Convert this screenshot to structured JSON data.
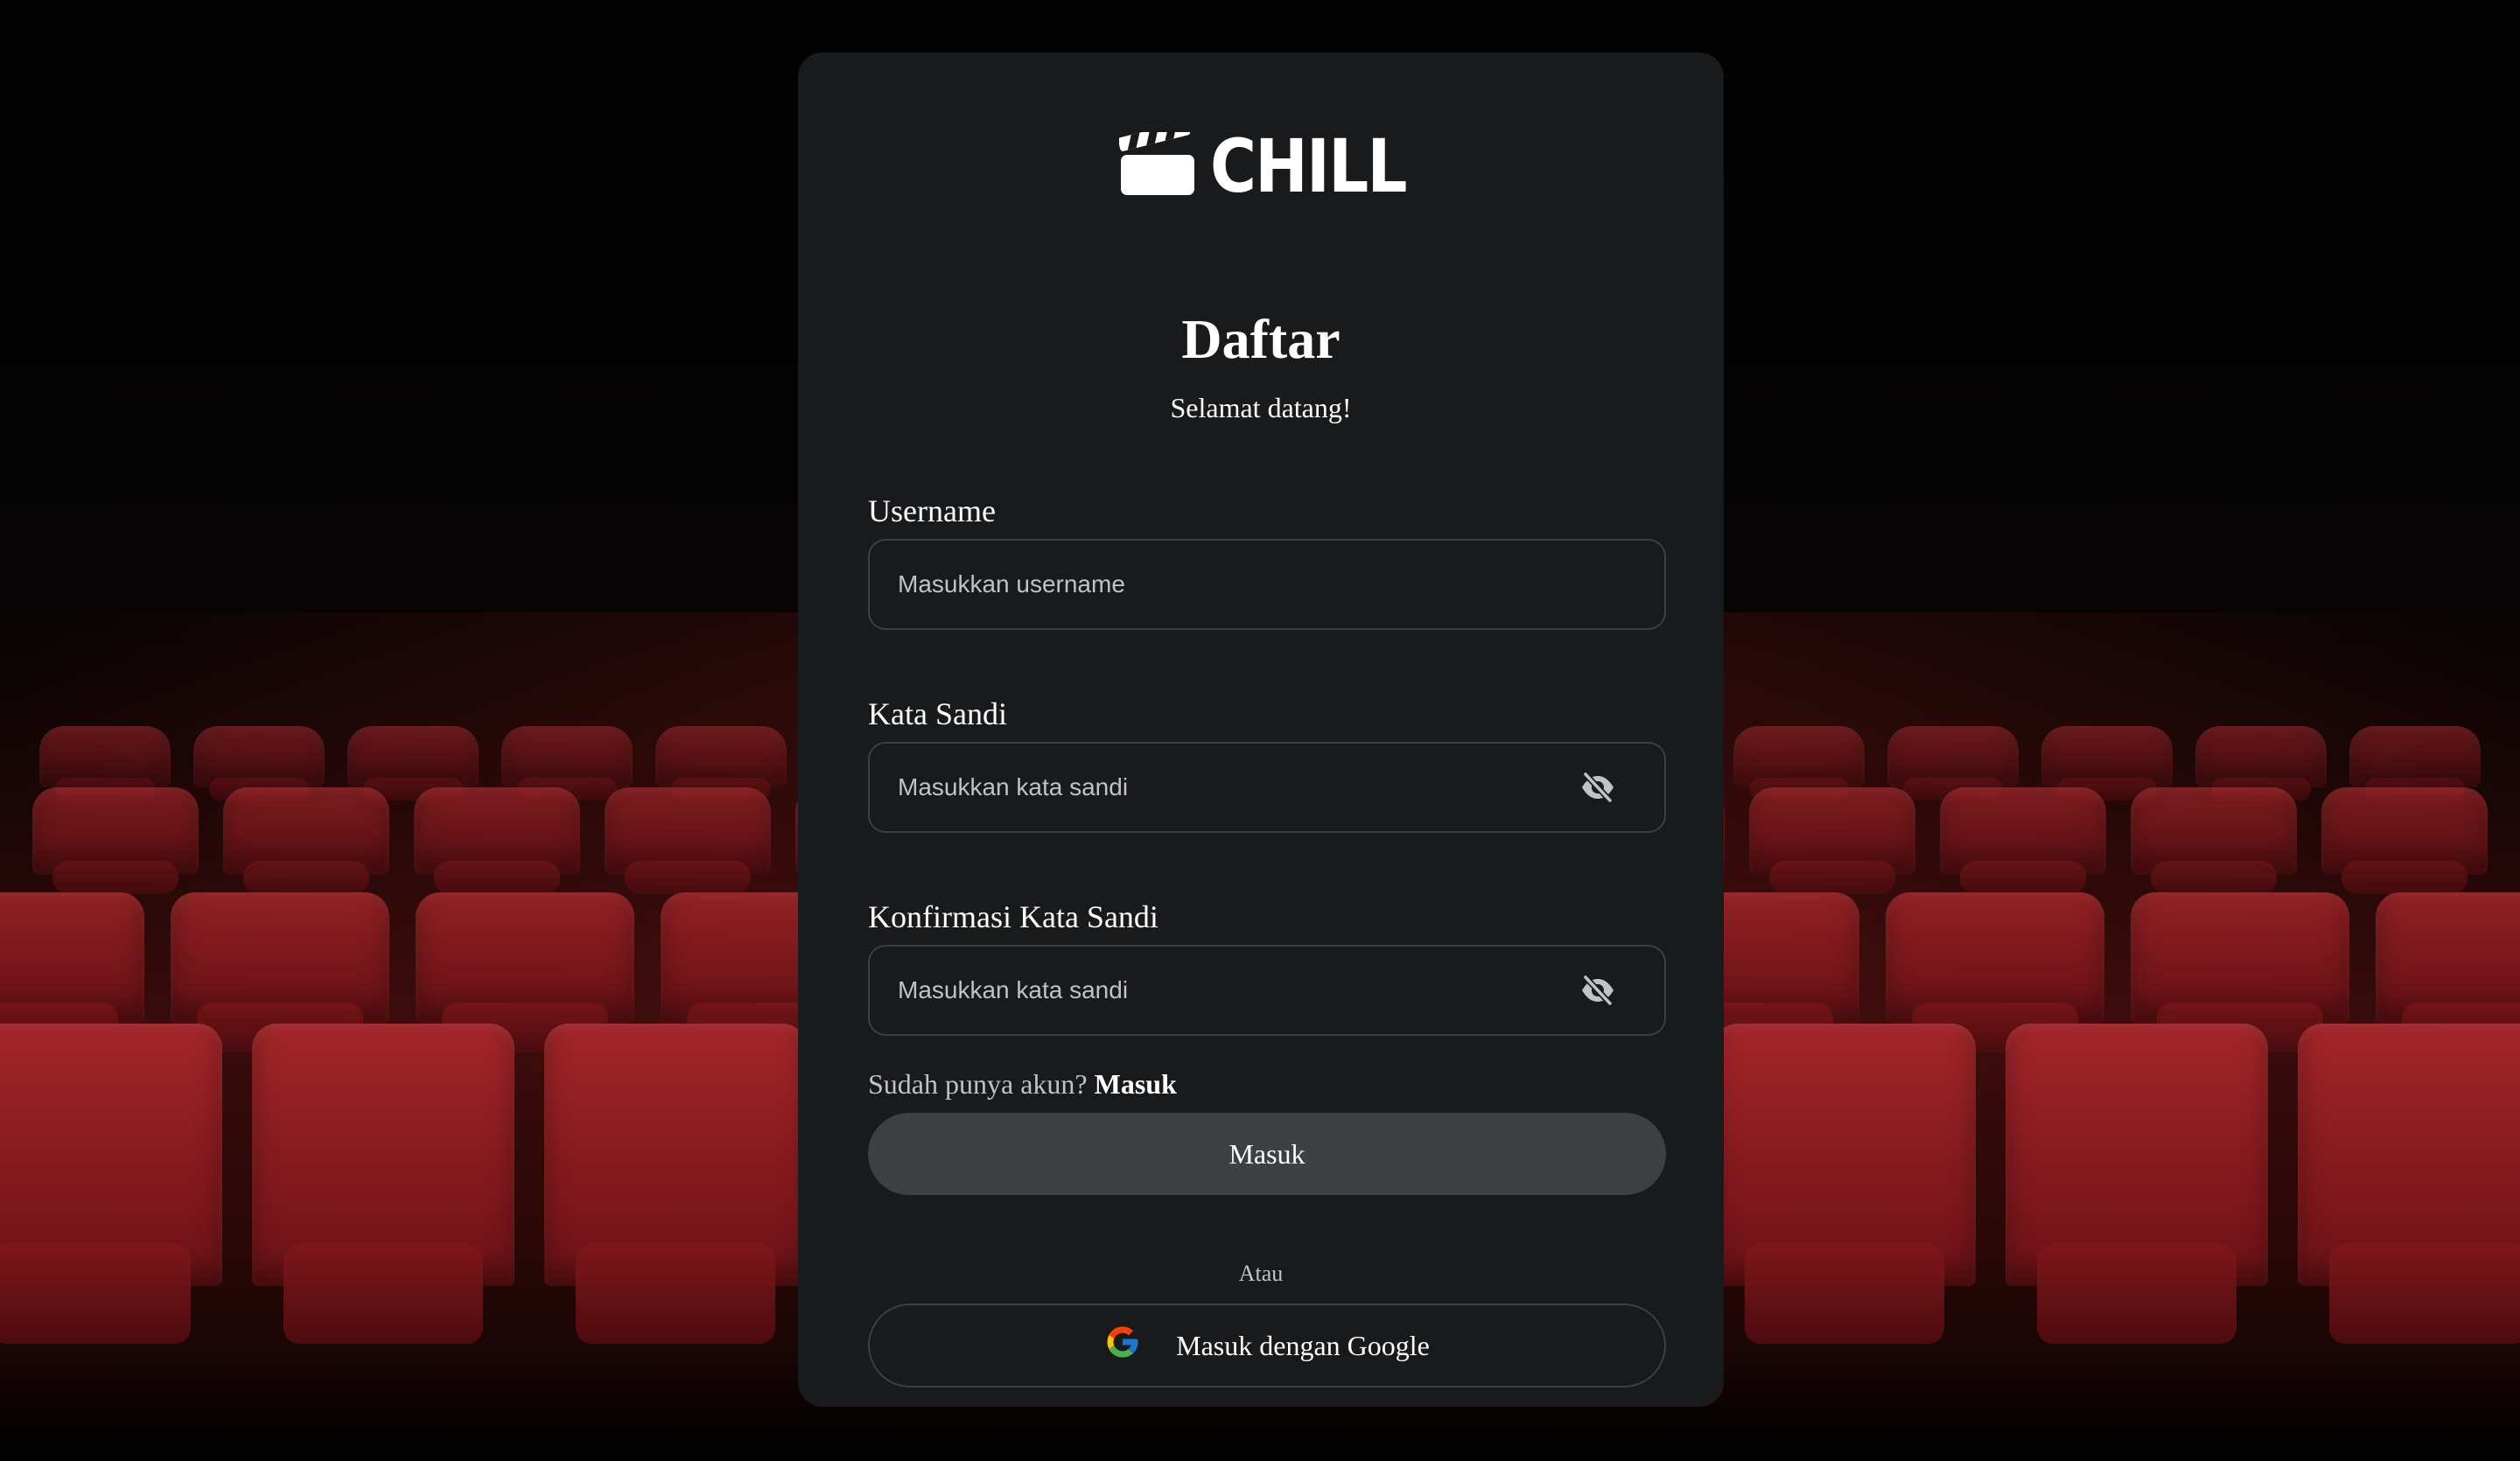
{
  "brand": {
    "name": "CHILL",
    "logo_icon": "clapperboard-icon"
  },
  "form": {
    "title": "Daftar",
    "subtitle": "Selamat datang!",
    "username": {
      "label": "Username",
      "placeholder": "Masukkan username",
      "value": ""
    },
    "password": {
      "label": "Kata Sandi",
      "placeholder": "Masukkan kata sandi",
      "value": "",
      "toggle_icon": "eye-slash-icon"
    },
    "confirm_password": {
      "label": "Konfirmasi Kata Sandi",
      "placeholder": "Masukkan kata sandi",
      "value": "",
      "toggle_icon": "eye-slash-icon"
    },
    "signin_prompt": "Sudah punya akun?",
    "signin_link": "Masuk",
    "submit_label": "Masuk",
    "divider_text": "Atau",
    "google_label": "Masuk dengan Google",
    "google_icon": "google-icon"
  },
  "colors": {
    "card_background": "#181a1c",
    "field_border": "#3c3e41",
    "primary_button": "#3d4143",
    "muted_text": "#c1c2c4",
    "seat_red": "#8a1c20"
  }
}
